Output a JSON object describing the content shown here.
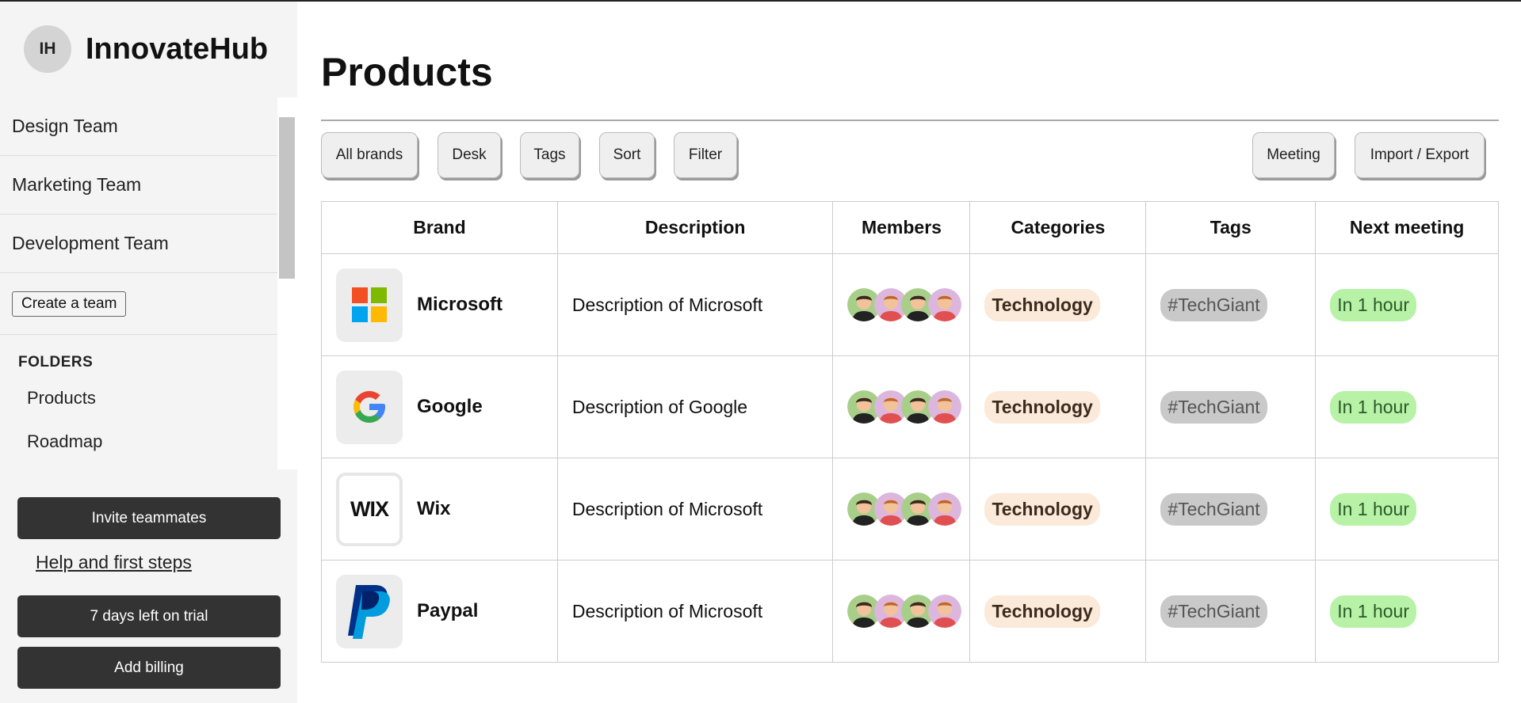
{
  "sidebar": {
    "workspace_initials": "IH",
    "workspace_name": "InnovateHub",
    "teams": [
      {
        "label": "Design Team"
      },
      {
        "label": "Marketing Team"
      },
      {
        "label": "Development Team"
      }
    ],
    "create_team_label": "Create a team",
    "folders_title": "FOLDERS",
    "folders": [
      {
        "label": "Products"
      },
      {
        "label": "Roadmap"
      }
    ],
    "invite_label": "Invite teammates",
    "help_label": "Help and first steps",
    "trial_label": "7 days left on trial",
    "billing_label": "Add billing"
  },
  "main": {
    "title": "Products",
    "toolbar": {
      "all_brands": "All brands",
      "desk": "Desk",
      "tags": "Tags",
      "sort": "Sort",
      "filter": "Filter",
      "meeting": "Meeting",
      "import_export": "Import / Export"
    },
    "table": {
      "headers": {
        "brand": "Brand",
        "description": "Description",
        "members": "Members",
        "categories": "Categories",
        "tags": "Tags",
        "next_meeting": "Next meeting"
      },
      "rows": [
        {
          "brand": "Microsoft",
          "logo": "microsoft-logo",
          "description": "Description of Microsoft",
          "category": "Technology",
          "tag": "#TechGiant",
          "next_meeting": "In 1 hour"
        },
        {
          "brand": "Google",
          "logo": "google-logo",
          "description": "Description of Google",
          "category": "Technology",
          "tag": "#TechGiant",
          "next_meeting": "In 1 hour"
        },
        {
          "brand": "Wix",
          "logo": "wix-logo",
          "logo_text": "WIX",
          "description": "Description of Microsoft",
          "category": "Technology",
          "tag": "#TechGiant",
          "next_meeting": "In 1 hour"
        },
        {
          "brand": "Paypal",
          "logo": "paypal-logo",
          "description": "Description of Microsoft",
          "category": "Technology",
          "tag": "#TechGiant",
          "next_meeting": "In 1 hour"
        }
      ]
    }
  },
  "colors": {
    "dark_button": "#333333",
    "category_bg": "#fbe9d9",
    "tag_bg": "#c9c9c9",
    "meeting_bg": "#b7f2a7"
  }
}
